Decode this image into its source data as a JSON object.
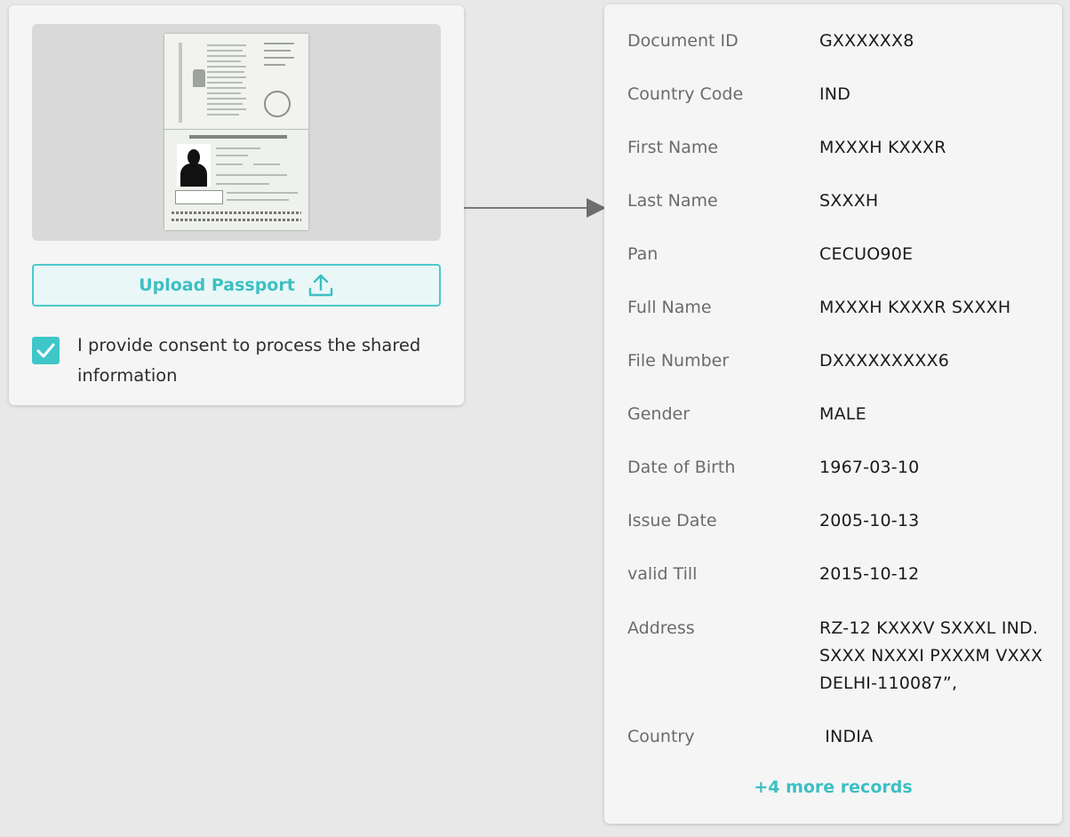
{
  "upload": {
    "label": "Upload Passport",
    "icon": "upload-icon"
  },
  "consent": {
    "checked": true,
    "text": "I provide consent to process the shared information"
  },
  "records": [
    {
      "label": "Document ID",
      "value": "GXXXXXX8"
    },
    {
      "label": "Country Code",
      "value": "IND"
    },
    {
      "label": "First Name",
      "value": "MXXXH KXXXR"
    },
    {
      "label": "Last Name",
      "value": "SXXXH"
    },
    {
      "label": "Pan",
      "value": "CECUO90E"
    },
    {
      "label": "Full Name",
      "value": "MXXXH KXXXR SXXXH"
    },
    {
      "label": "File Number",
      "value": "DXXXXXXXXX6"
    },
    {
      "label": "Gender",
      "value": "MALE"
    },
    {
      "label": "Date of Birth",
      "value": "1967-03-10"
    },
    {
      "label": "Issue Date",
      "value": "2005-10-13"
    },
    {
      "label": "valid Till",
      "value": "2015-10-12"
    },
    {
      "label": "Address",
      "value": "RZ-12 KXXXV SXXXL IND. SXXX NXXXI PXXXM VXXX DELHI-110087”,"
    },
    {
      "label": "Country",
      "value": " INDIA"
    }
  ],
  "more_records": "+4 more records",
  "colors": {
    "accent": "#3dbfc3",
    "background": "#e8e8e8",
    "card": "#f5f5f5"
  }
}
